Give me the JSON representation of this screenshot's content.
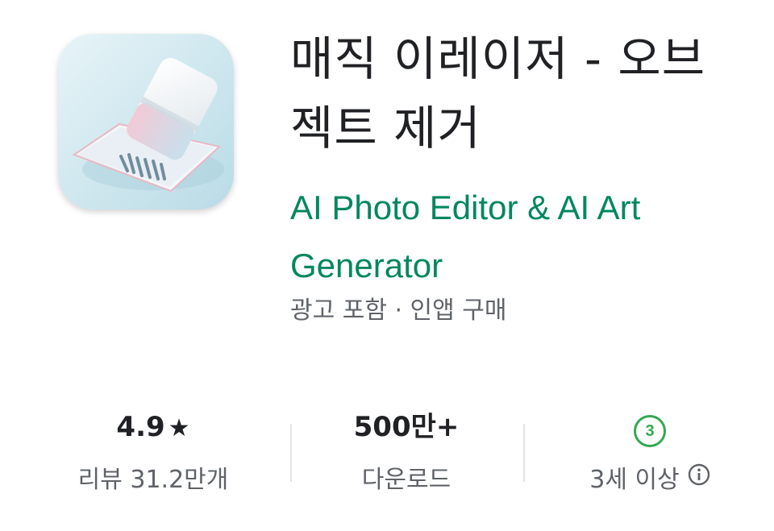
{
  "app": {
    "title": "매직 이레이저 - 오브젝트 제거",
    "developer": "AI Photo Editor & AI Art Generator",
    "meta": "광고 포함 · 인앱 구매",
    "icon": "eraser-app-icon"
  },
  "stats": {
    "rating": {
      "value": "4.9",
      "star": "★",
      "label": "리뷰 31.2만개"
    },
    "downloads": {
      "value": "500만+",
      "label": "다운로드"
    },
    "age": {
      "badge": "3",
      "label": "3세 이상",
      "icon": "info-icon"
    }
  },
  "colors": {
    "developer": "#01875f",
    "age_badge": "#34a853",
    "text_primary": "#202124",
    "text_secondary": "#5f6368"
  }
}
